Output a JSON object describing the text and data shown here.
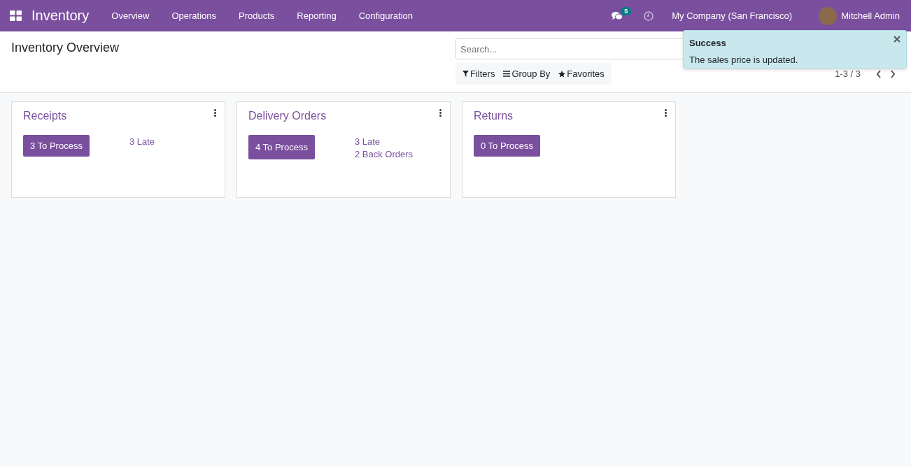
{
  "navbar": {
    "app_name": "Inventory",
    "menu": [
      "Overview",
      "Operations",
      "Products",
      "Reporting",
      "Configuration"
    ],
    "messages_badge": "5",
    "company": "My Company (San Francisco)",
    "user": "Mitchell Admin"
  },
  "control_panel": {
    "title": "Inventory Overview",
    "search": {
      "placeholder": "Search..."
    },
    "filters": [
      "Filters",
      "Group By",
      "Favorites"
    ],
    "pager": "1-3 / 3"
  },
  "cards": [
    {
      "title": "Receipts",
      "button": "3 To Process",
      "links": [
        "3 Late"
      ]
    },
    {
      "title": "Delivery Orders",
      "button": "4 To Process",
      "links": [
        "3 Late",
        "2 Back Orders"
      ]
    },
    {
      "title": "Returns",
      "button": "0 To Process"
    }
  ],
  "toast": {
    "title": "Success",
    "message": "The sales price is updated."
  }
}
